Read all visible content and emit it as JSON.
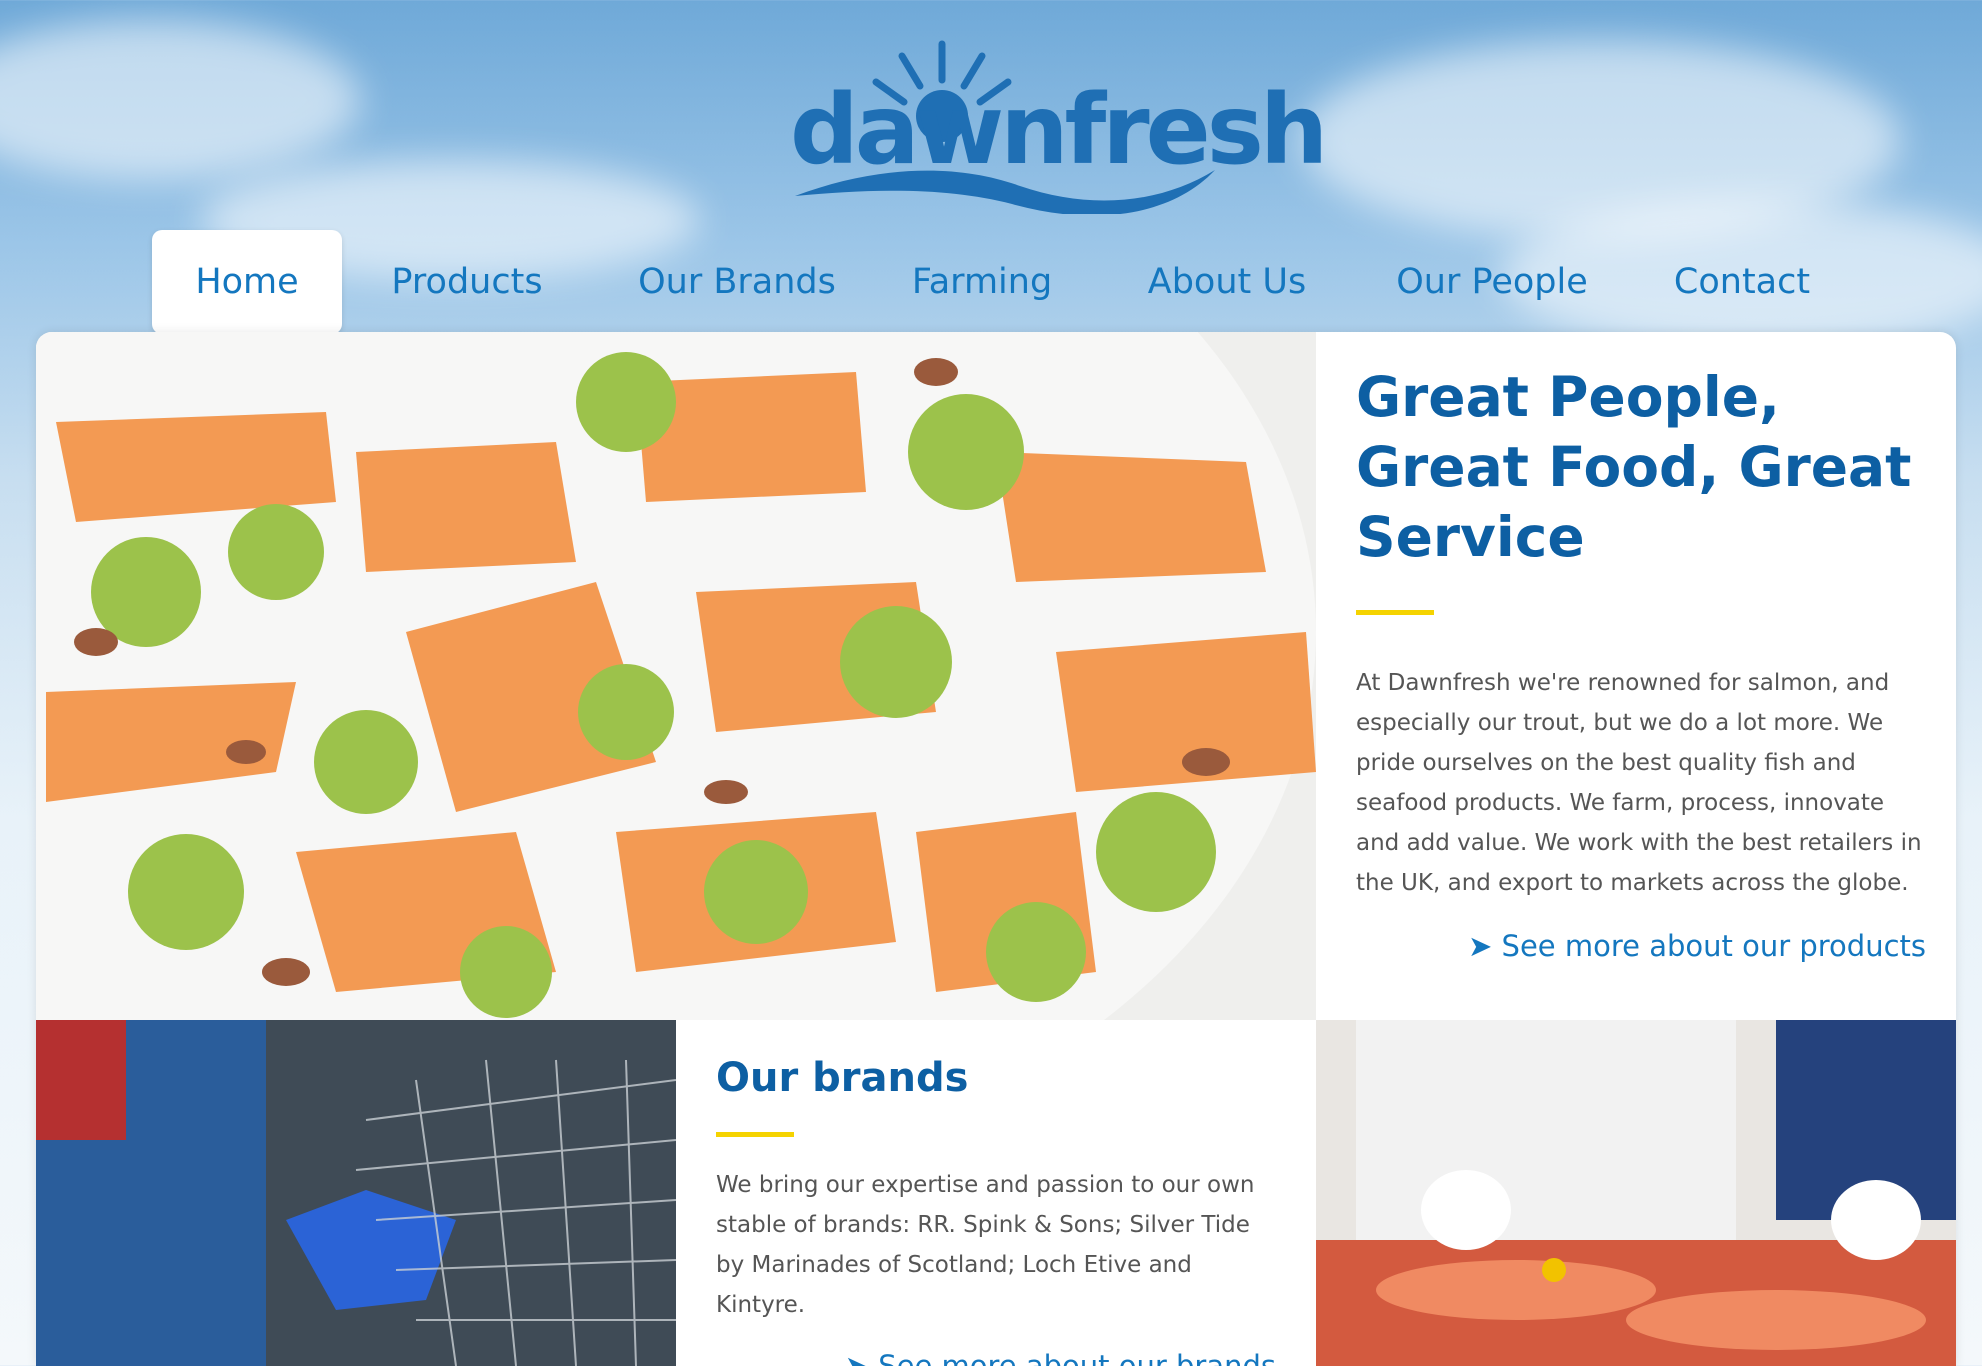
{
  "brand": {
    "logo_text": "dawnfresh"
  },
  "nav": {
    "items": [
      {
        "label": "Home",
        "active": true
      },
      {
        "label": "Products"
      },
      {
        "label": "Our Brands"
      },
      {
        "label": "Farming"
      },
      {
        "label": "About Us"
      },
      {
        "label": "Our People"
      },
      {
        "label": "Contact"
      }
    ]
  },
  "hero": {
    "title": "Great People, Great Food, Great Service",
    "body": "At Dawnfresh we're renowned for salmon, and especially our trout, but we do a lot more. We pride ourselves on the best quality fish and seafood products. We farm, process, innovate and add value. We work with the best retailers in the UK, and export to markets across the globe.",
    "link": "See more about our products",
    "link_icon": "arrow-right-icon"
  },
  "brands": {
    "title": "Our brands",
    "body": "We bring our expertise and passion to our own stable of brands: RR. Spink & Sons; Silver Tide by Marinades of Scotland; Loch Etive and Kintyre.",
    "link": "See more about our brands",
    "link_icon": "arrow-right-icon"
  },
  "colors": {
    "accent": "#1477bf",
    "heading": "#0d5fa3",
    "rule": "#f5d300"
  }
}
